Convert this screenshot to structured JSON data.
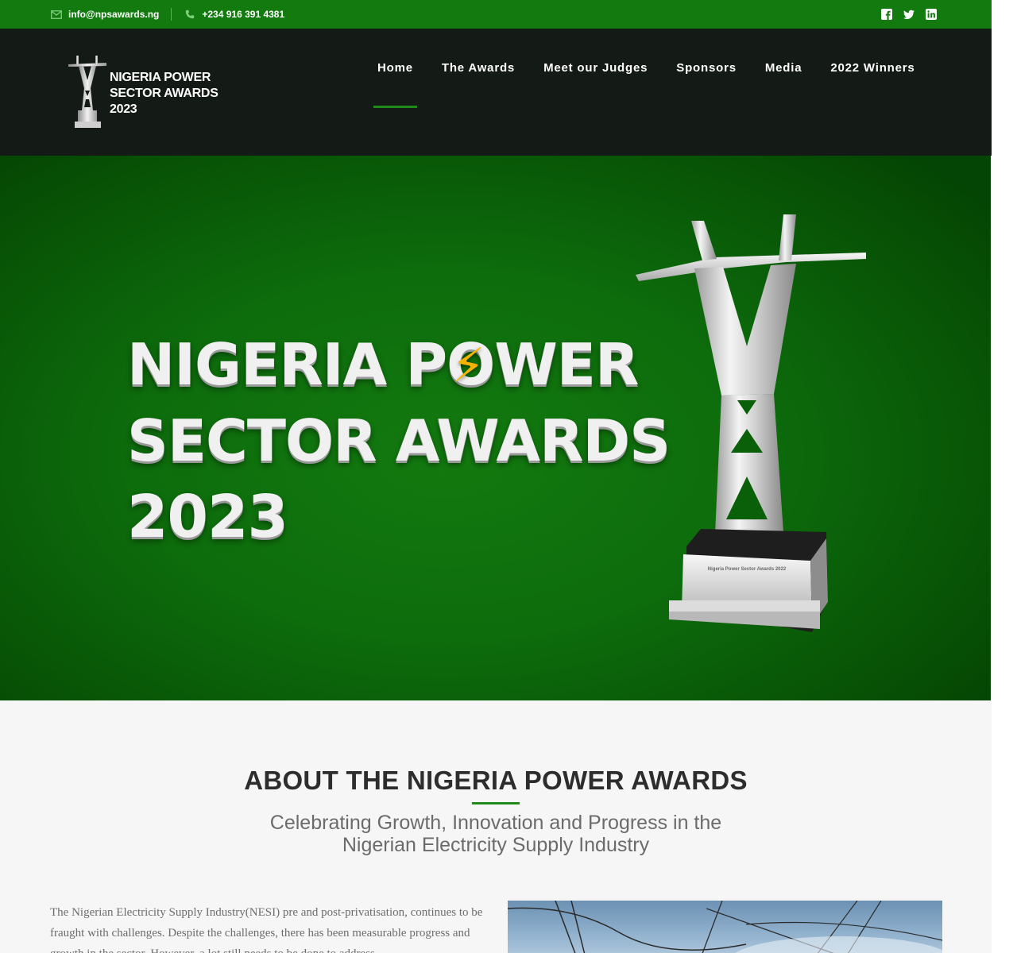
{
  "topbar": {
    "email": "info@npsawards.ng",
    "phone": "+234 916 391 4381",
    "email_icon": "envelope-icon",
    "phone_icon": "phone-icon",
    "social": [
      {
        "name": "facebook",
        "icon": "facebook-icon"
      },
      {
        "name": "twitter",
        "icon": "twitter-icon"
      },
      {
        "name": "linkedin",
        "icon": "linkedin-icon"
      }
    ],
    "background_color": "#137a10"
  },
  "header": {
    "logo": {
      "line1": "NIGERIA POWER",
      "line2": "SECTOR AWARDS",
      "line3": "2023"
    },
    "nav": [
      {
        "label": "Home",
        "active": true
      },
      {
        "label": "The Awards",
        "active": false
      },
      {
        "label": "Meet our Judges",
        "active": false
      },
      {
        "label": "Sponsors",
        "active": false
      },
      {
        "label": "Media",
        "active": false
      },
      {
        "label": "2022 Winners",
        "active": false
      }
    ],
    "accent_color": "#1f8a1a"
  },
  "hero": {
    "line1": "NIGERIA POWER",
    "line2": "SECTOR AWARDS",
    "line3": "2023",
    "trophy_plaque": "Nigeria Power Sector Awards 2022"
  },
  "about": {
    "title": "ABOUT THE NIGERIA POWER AWARDS",
    "subtitle": "Celebrating Growth, Innovation and Progress in the Nigerian Electricity Supply Industry",
    "body": "The Nigerian Electricity Supply Industry(NESI) pre and post-privatisation, continues to be fraught with challenges. Despite the challenges, there has been measurable progress and growth in the sector. However, a lot still needs to be done to address"
  }
}
